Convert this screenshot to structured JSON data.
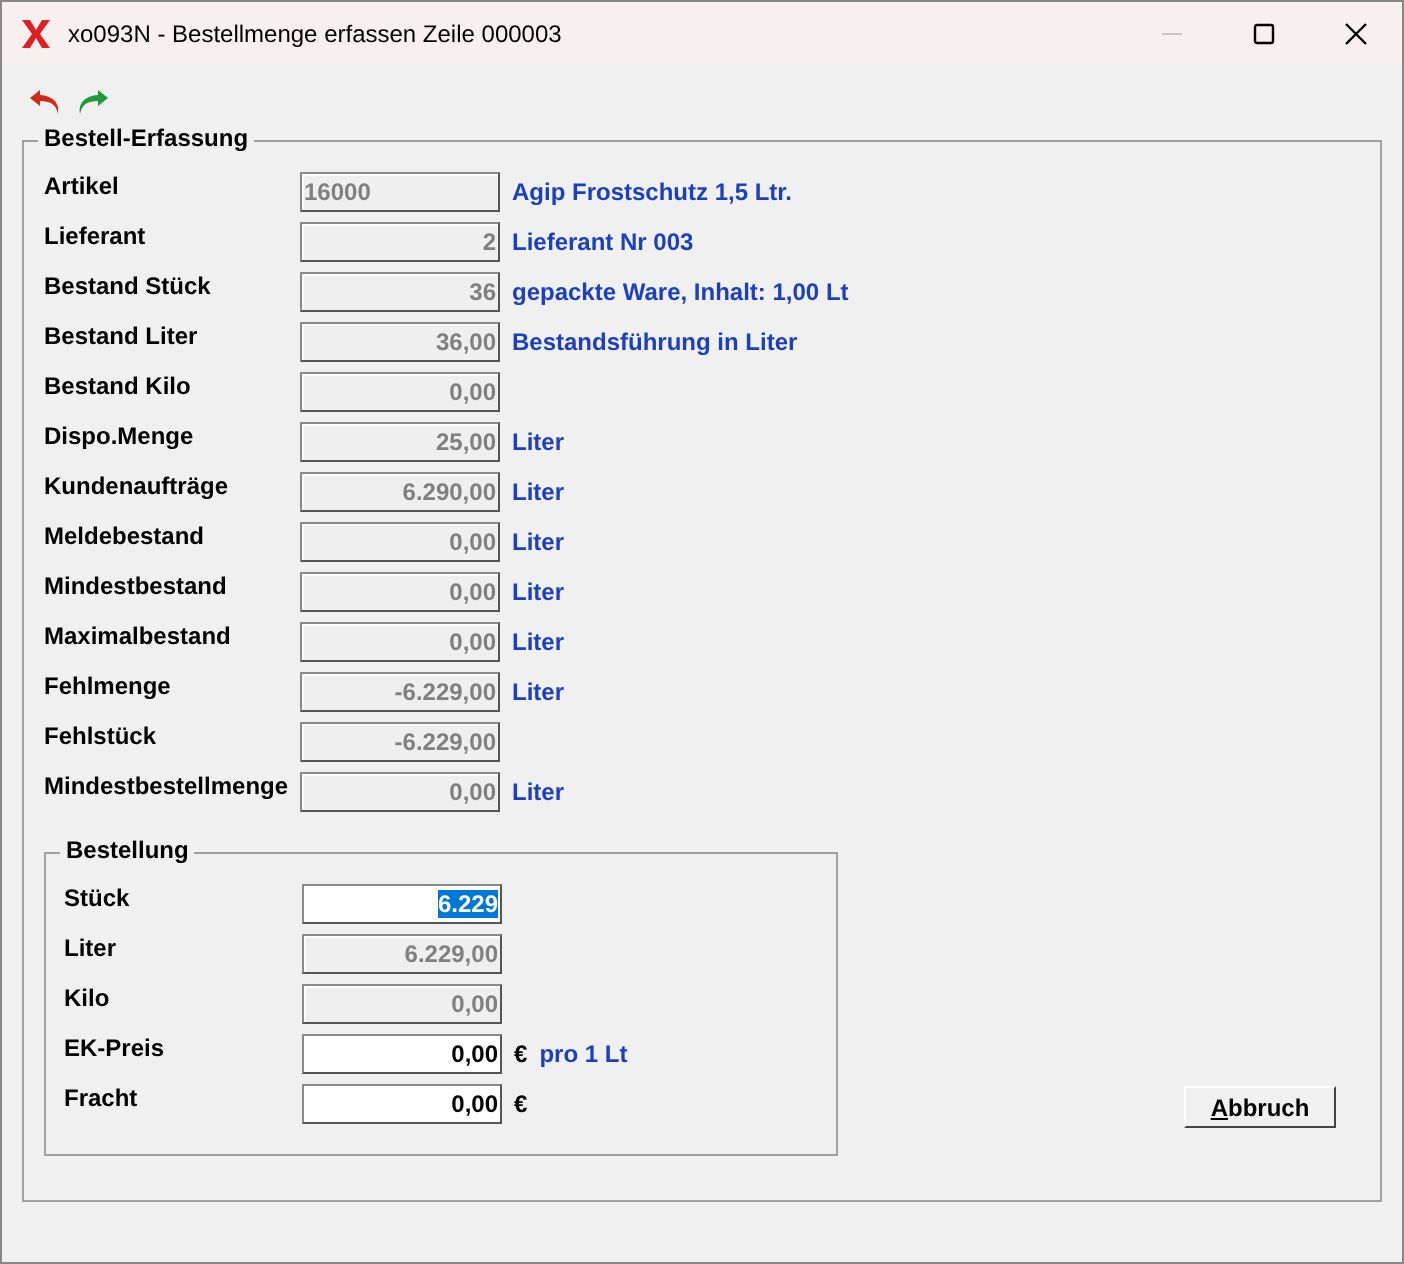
{
  "window": {
    "title": "xo093N - Bestellmenge erfassen Zeile 000003",
    "minimize_disabled": true
  },
  "group": {
    "title": "Bestell-Erfassung",
    "rows": [
      {
        "label": "Artikel",
        "value": "16000",
        "kind": "text",
        "note": "Agip Frostschutz 1,5 Ltr."
      },
      {
        "label": "Lieferant",
        "value": "2",
        "kind": "number",
        "note": "Lieferant Nr 003"
      },
      {
        "label": "Bestand Stück",
        "value": "36",
        "kind": "number",
        "note": "gepackte Ware, Inhalt: 1,00 Lt"
      },
      {
        "label": "Bestand Liter",
        "value": "36,00",
        "kind": "number",
        "note": "Bestandsführung in Liter"
      },
      {
        "label": "Bestand Kilo",
        "value": "0,00",
        "kind": "number"
      },
      {
        "label": "Dispo.Menge",
        "value": "25,00",
        "kind": "number",
        "note": "Liter"
      },
      {
        "label": "Kundenaufträge",
        "value": "6.290,00",
        "kind": "number",
        "note": "Liter"
      },
      {
        "label": "Meldebestand",
        "value": "0,00",
        "kind": "number",
        "note": "Liter"
      },
      {
        "label": "Mindestbestand",
        "value": "0,00",
        "kind": "number",
        "note": "Liter"
      },
      {
        "label": "Maximalbestand",
        "value": "0,00",
        "kind": "number",
        "note": "Liter"
      },
      {
        "label": "Fehlmenge",
        "value": "-6.229,00",
        "kind": "number",
        "note": "Liter"
      },
      {
        "label": "Fehlstück",
        "value": "-6.229,00",
        "kind": "number"
      },
      {
        "label": "Mindestbestellmenge",
        "value": "0,00",
        "kind": "number",
        "note": "Liter"
      }
    ]
  },
  "order": {
    "title": "Bestellung",
    "rows": [
      {
        "label": "Stück",
        "value": "6.229",
        "editable": true,
        "selected": true
      },
      {
        "label": "Liter",
        "value": "6.229,00",
        "editable": false,
        "selected": false
      },
      {
        "label": "Kilo",
        "value": "0,00",
        "editable": false,
        "selected": false
      },
      {
        "label": "EK-Preis",
        "value": "0,00",
        "editable": true,
        "selected": false,
        "unit": "€",
        "note": "pro 1 Lt"
      },
      {
        "label": "Fracht",
        "value": "0,00",
        "editable": true,
        "selected": false,
        "unit": "€"
      }
    ]
  },
  "buttons": [
    {
      "label": "Abbruch"
    }
  ]
}
